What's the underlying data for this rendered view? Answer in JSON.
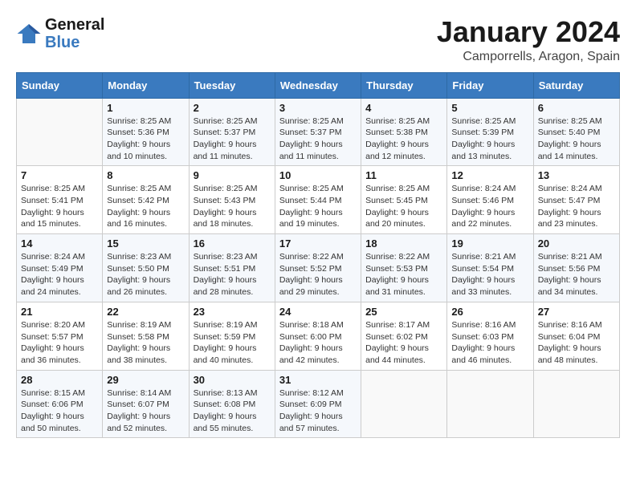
{
  "header": {
    "logo_line1": "General",
    "logo_line2": "Blue",
    "month": "January 2024",
    "location": "Camporrells, Aragon, Spain"
  },
  "weekdays": [
    "Sunday",
    "Monday",
    "Tuesday",
    "Wednesday",
    "Thursday",
    "Friday",
    "Saturday"
  ],
  "weeks": [
    [
      {
        "day": "",
        "info": ""
      },
      {
        "day": "1",
        "info": "Sunrise: 8:25 AM\nSunset: 5:36 PM\nDaylight: 9 hours\nand 10 minutes."
      },
      {
        "day": "2",
        "info": "Sunrise: 8:25 AM\nSunset: 5:37 PM\nDaylight: 9 hours\nand 11 minutes."
      },
      {
        "day": "3",
        "info": "Sunrise: 8:25 AM\nSunset: 5:37 PM\nDaylight: 9 hours\nand 11 minutes."
      },
      {
        "day": "4",
        "info": "Sunrise: 8:25 AM\nSunset: 5:38 PM\nDaylight: 9 hours\nand 12 minutes."
      },
      {
        "day": "5",
        "info": "Sunrise: 8:25 AM\nSunset: 5:39 PM\nDaylight: 9 hours\nand 13 minutes."
      },
      {
        "day": "6",
        "info": "Sunrise: 8:25 AM\nSunset: 5:40 PM\nDaylight: 9 hours\nand 14 minutes."
      }
    ],
    [
      {
        "day": "7",
        "info": "Sunrise: 8:25 AM\nSunset: 5:41 PM\nDaylight: 9 hours\nand 15 minutes."
      },
      {
        "day": "8",
        "info": "Sunrise: 8:25 AM\nSunset: 5:42 PM\nDaylight: 9 hours\nand 16 minutes."
      },
      {
        "day": "9",
        "info": "Sunrise: 8:25 AM\nSunset: 5:43 PM\nDaylight: 9 hours\nand 18 minutes."
      },
      {
        "day": "10",
        "info": "Sunrise: 8:25 AM\nSunset: 5:44 PM\nDaylight: 9 hours\nand 19 minutes."
      },
      {
        "day": "11",
        "info": "Sunrise: 8:25 AM\nSunset: 5:45 PM\nDaylight: 9 hours\nand 20 minutes."
      },
      {
        "day": "12",
        "info": "Sunrise: 8:24 AM\nSunset: 5:46 PM\nDaylight: 9 hours\nand 22 minutes."
      },
      {
        "day": "13",
        "info": "Sunrise: 8:24 AM\nSunset: 5:47 PM\nDaylight: 9 hours\nand 23 minutes."
      }
    ],
    [
      {
        "day": "14",
        "info": "Sunrise: 8:24 AM\nSunset: 5:49 PM\nDaylight: 9 hours\nand 24 minutes."
      },
      {
        "day": "15",
        "info": "Sunrise: 8:23 AM\nSunset: 5:50 PM\nDaylight: 9 hours\nand 26 minutes."
      },
      {
        "day": "16",
        "info": "Sunrise: 8:23 AM\nSunset: 5:51 PM\nDaylight: 9 hours\nand 28 minutes."
      },
      {
        "day": "17",
        "info": "Sunrise: 8:22 AM\nSunset: 5:52 PM\nDaylight: 9 hours\nand 29 minutes."
      },
      {
        "day": "18",
        "info": "Sunrise: 8:22 AM\nSunset: 5:53 PM\nDaylight: 9 hours\nand 31 minutes."
      },
      {
        "day": "19",
        "info": "Sunrise: 8:21 AM\nSunset: 5:54 PM\nDaylight: 9 hours\nand 33 minutes."
      },
      {
        "day": "20",
        "info": "Sunrise: 8:21 AM\nSunset: 5:56 PM\nDaylight: 9 hours\nand 34 minutes."
      }
    ],
    [
      {
        "day": "21",
        "info": "Sunrise: 8:20 AM\nSunset: 5:57 PM\nDaylight: 9 hours\nand 36 minutes."
      },
      {
        "day": "22",
        "info": "Sunrise: 8:19 AM\nSunset: 5:58 PM\nDaylight: 9 hours\nand 38 minutes."
      },
      {
        "day": "23",
        "info": "Sunrise: 8:19 AM\nSunset: 5:59 PM\nDaylight: 9 hours\nand 40 minutes."
      },
      {
        "day": "24",
        "info": "Sunrise: 8:18 AM\nSunset: 6:00 PM\nDaylight: 9 hours\nand 42 minutes."
      },
      {
        "day": "25",
        "info": "Sunrise: 8:17 AM\nSunset: 6:02 PM\nDaylight: 9 hours\nand 44 minutes."
      },
      {
        "day": "26",
        "info": "Sunrise: 8:16 AM\nSunset: 6:03 PM\nDaylight: 9 hours\nand 46 minutes."
      },
      {
        "day": "27",
        "info": "Sunrise: 8:16 AM\nSunset: 6:04 PM\nDaylight: 9 hours\nand 48 minutes."
      }
    ],
    [
      {
        "day": "28",
        "info": "Sunrise: 8:15 AM\nSunset: 6:06 PM\nDaylight: 9 hours\nand 50 minutes."
      },
      {
        "day": "29",
        "info": "Sunrise: 8:14 AM\nSunset: 6:07 PM\nDaylight: 9 hours\nand 52 minutes."
      },
      {
        "day": "30",
        "info": "Sunrise: 8:13 AM\nSunset: 6:08 PM\nDaylight: 9 hours\nand 55 minutes."
      },
      {
        "day": "31",
        "info": "Sunrise: 8:12 AM\nSunset: 6:09 PM\nDaylight: 9 hours\nand 57 minutes."
      },
      {
        "day": "",
        "info": ""
      },
      {
        "day": "",
        "info": ""
      },
      {
        "day": "",
        "info": ""
      }
    ]
  ]
}
